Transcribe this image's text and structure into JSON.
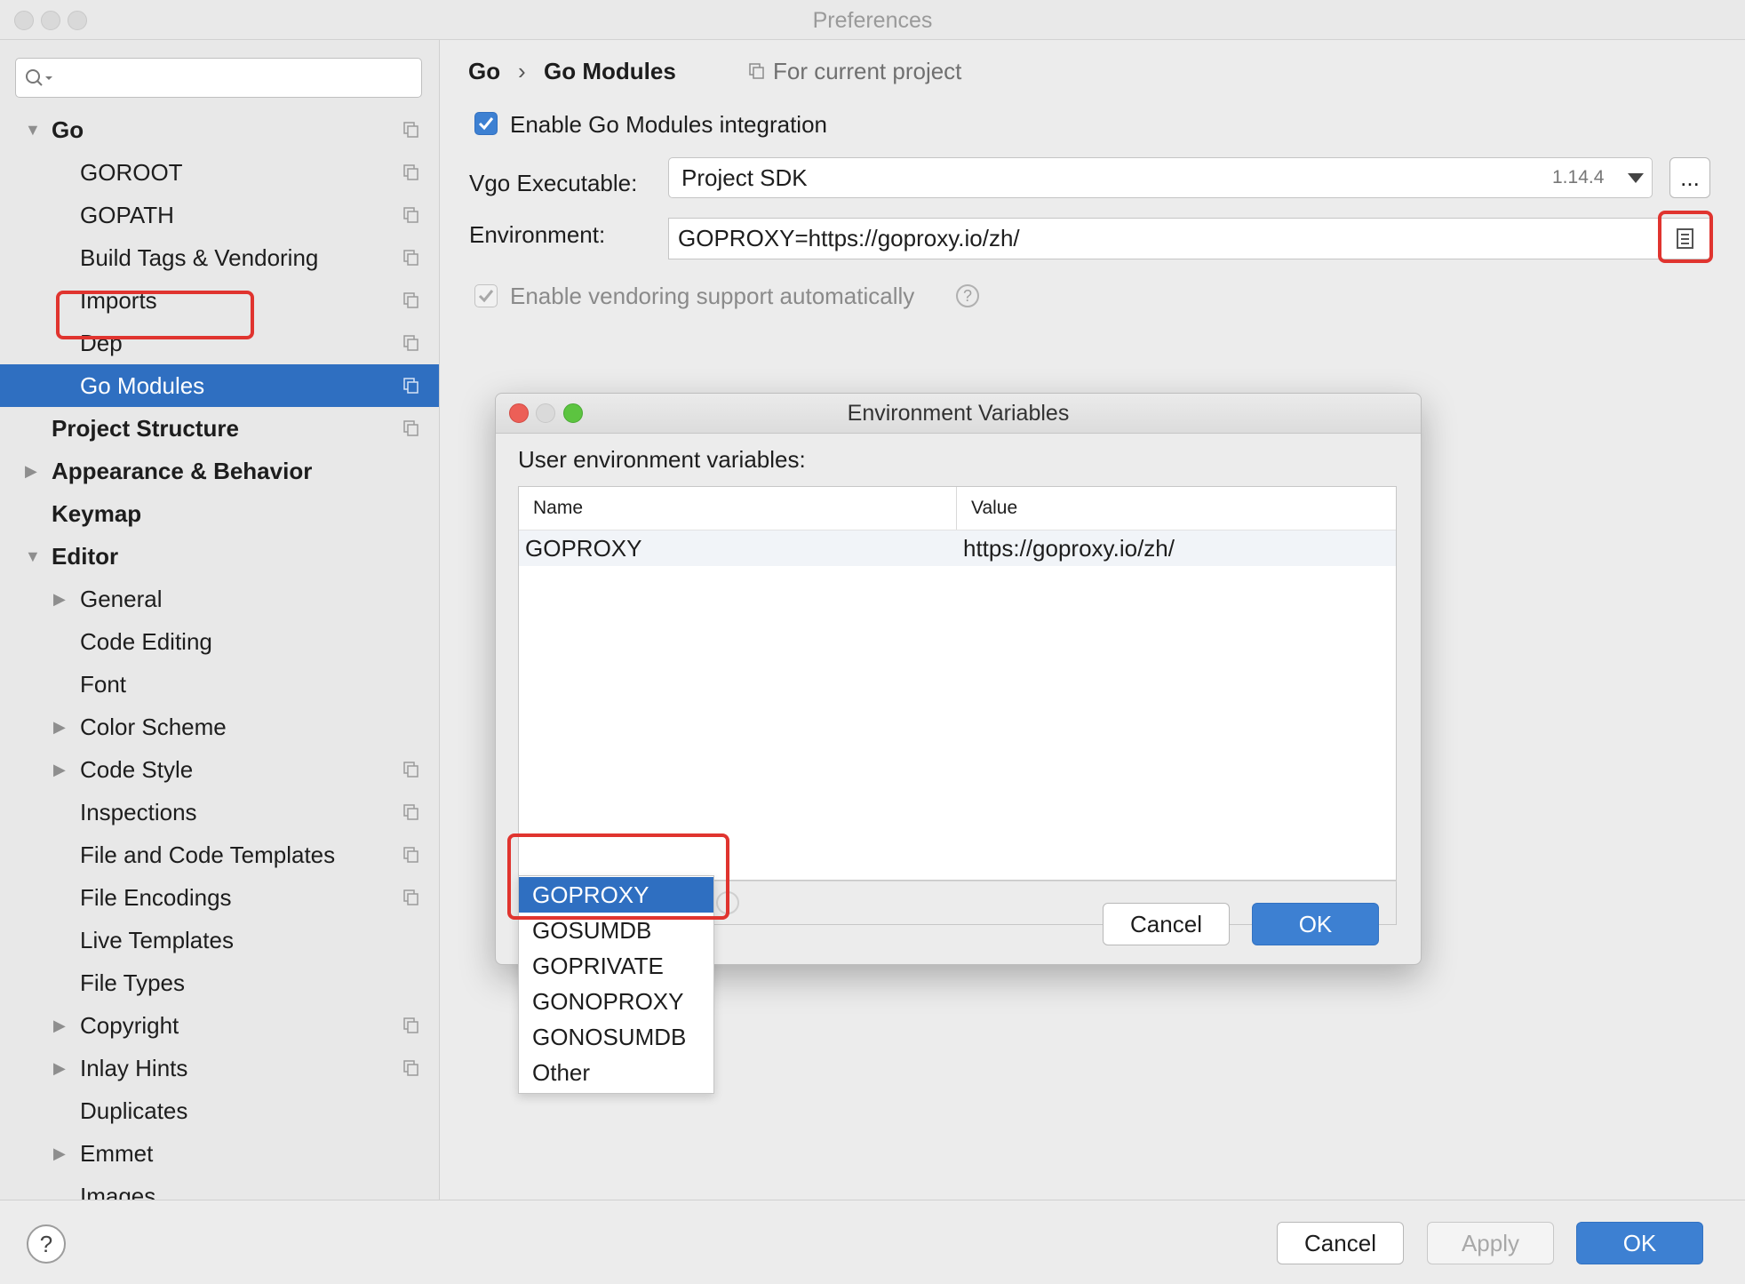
{
  "window": {
    "title": "Preferences"
  },
  "sidebar": {
    "search": {
      "placeholder": "",
      "value": ""
    },
    "items": [
      {
        "label": "Go",
        "bold": true,
        "expanded": true,
        "copy_icon": true
      },
      {
        "label": "GOROOT",
        "copy_icon": true
      },
      {
        "label": "GOPATH",
        "copy_icon": true
      },
      {
        "label": "Build Tags & Vendoring",
        "copy_icon": true
      },
      {
        "label": "Imports",
        "copy_icon": true
      },
      {
        "label": "Dep",
        "copy_icon": true
      },
      {
        "label": "Go Modules",
        "selected": true,
        "copy_icon": true
      },
      {
        "label": "Project Structure",
        "bold": true,
        "copy_icon": true
      },
      {
        "label": "Appearance & Behavior",
        "bold": true,
        "expandable": true
      },
      {
        "label": "Keymap",
        "bold": true
      },
      {
        "label": "Editor",
        "bold": true,
        "expanded": true
      },
      {
        "label": "General",
        "expandable": true
      },
      {
        "label": "Code Editing"
      },
      {
        "label": "Font"
      },
      {
        "label": "Color Scheme",
        "expandable": true
      },
      {
        "label": "Code Style",
        "expandable": true,
        "copy_icon": true
      },
      {
        "label": "Inspections",
        "copy_icon": true
      },
      {
        "label": "File and Code Templates",
        "copy_icon": true
      },
      {
        "label": "File Encodings",
        "copy_icon": true
      },
      {
        "label": "Live Templates"
      },
      {
        "label": "File Types"
      },
      {
        "label": "Copyright",
        "expandable": true,
        "copy_icon": true
      },
      {
        "label": "Inlay Hints",
        "expandable": true,
        "copy_icon": true
      },
      {
        "label": "Duplicates"
      },
      {
        "label": "Emmet",
        "expandable": true
      },
      {
        "label": "Images"
      }
    ]
  },
  "content": {
    "breadcrumb": {
      "parent": "Go",
      "separator": "›",
      "current": "Go Modules",
      "scope": "For current project"
    },
    "enable_modules": {
      "label": "Enable Go Modules integration",
      "checked": true
    },
    "vgo_executable": {
      "label": "Vgo Executable:",
      "value": "Project SDK",
      "version": "1.14.4",
      "browse_label": "..."
    },
    "environment": {
      "label": "Environment:",
      "value": "GOPROXY=https://goproxy.io/zh/"
    },
    "enable_vendoring": {
      "label": "Enable vendoring support automatically",
      "checked": true,
      "disabled": true,
      "help": "?"
    }
  },
  "dialog": {
    "title": "Environment Variables",
    "subtitle": "User environment variables:",
    "columns": [
      "Name",
      "Value"
    ],
    "rows": [
      {
        "name": "GOPROXY",
        "value": "https://goproxy.io/zh/"
      }
    ],
    "toolbar": {
      "add": "+",
      "remove": "−"
    },
    "popup_items": [
      "GOPROXY",
      "GOSUMDB",
      "GOPRIVATE",
      "GONOPROXY",
      "GONOSUMDB",
      "Other"
    ],
    "popup_selected": "GOPROXY",
    "cancel_label": "Cancel",
    "ok_label": "OK"
  },
  "footer": {
    "help": "?",
    "cancel_label": "Cancel",
    "apply_label": "Apply",
    "ok_label": "OK"
  },
  "colors": {
    "accent": "#2f6fc1",
    "highlight": "#e0342f",
    "checkbox": "#3d80d2"
  }
}
